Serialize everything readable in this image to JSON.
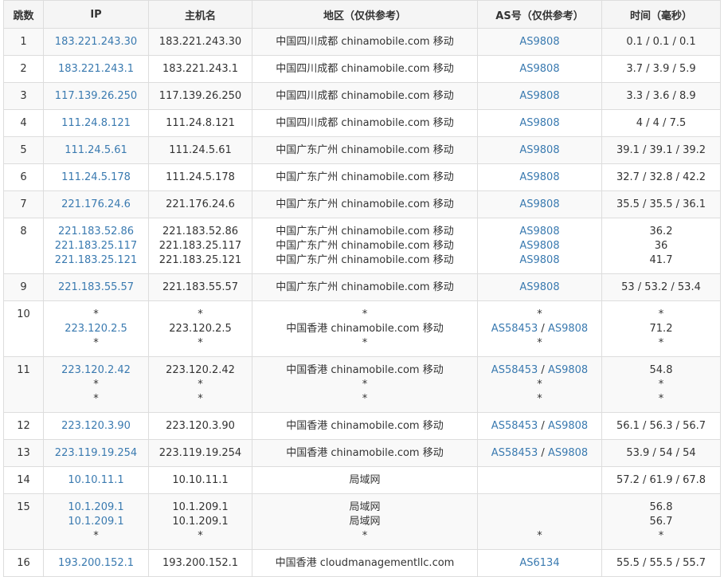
{
  "headers": [
    "跳数",
    "IP",
    "主机名",
    "地区（仅供参考）",
    "AS号（仅供参考）",
    "时间（毫秒）"
  ],
  "rows": [
    {
      "hop": "1",
      "ip": [
        "183.221.243.30"
      ],
      "host": [
        "183.221.243.30"
      ],
      "region": [
        "中国四川成都 chinamobile.com 移动"
      ],
      "as": [
        [
          "AS9808"
        ]
      ],
      "time": [
        "0.1 / 0.1 / 0.1"
      ]
    },
    {
      "hop": "2",
      "ip": [
        "183.221.243.1"
      ],
      "host": [
        "183.221.243.1"
      ],
      "region": [
        "中国四川成都 chinamobile.com 移动"
      ],
      "as": [
        [
          "AS9808"
        ]
      ],
      "time": [
        "3.7 / 3.9 / 5.9"
      ]
    },
    {
      "hop": "3",
      "ip": [
        "117.139.26.250"
      ],
      "host": [
        "117.139.26.250"
      ],
      "region": [
        "中国四川成都 chinamobile.com 移动"
      ],
      "as": [
        [
          "AS9808"
        ]
      ],
      "time": [
        "3.3 / 3.6 / 8.9"
      ]
    },
    {
      "hop": "4",
      "ip": [
        "111.24.8.121"
      ],
      "host": [
        "111.24.8.121"
      ],
      "region": [
        "中国四川成都 chinamobile.com 移动"
      ],
      "as": [
        [
          "AS9808"
        ]
      ],
      "time": [
        "4 / 4 / 7.5"
      ]
    },
    {
      "hop": "5",
      "ip": [
        "111.24.5.61"
      ],
      "host": [
        "111.24.5.61"
      ],
      "region": [
        "中国广东广州 chinamobile.com 移动"
      ],
      "as": [
        [
          "AS9808"
        ]
      ],
      "time": [
        "39.1 / 39.1 / 39.2"
      ]
    },
    {
      "hop": "6",
      "ip": [
        "111.24.5.178"
      ],
      "host": [
        "111.24.5.178"
      ],
      "region": [
        "中国广东广州 chinamobile.com 移动"
      ],
      "as": [
        [
          "AS9808"
        ]
      ],
      "time": [
        "32.7 / 32.8 / 42.2"
      ]
    },
    {
      "hop": "7",
      "ip": [
        "221.176.24.6"
      ],
      "host": [
        "221.176.24.6"
      ],
      "region": [
        "中国广东广州 chinamobile.com 移动"
      ],
      "as": [
        [
          "AS9808"
        ]
      ],
      "time": [
        "35.5 / 35.5 / 36.1"
      ]
    },
    {
      "hop": "8",
      "ip": [
        "221.183.52.86",
        "221.183.25.117",
        "221.183.25.121"
      ],
      "host": [
        "221.183.52.86",
        "221.183.25.117",
        "221.183.25.121"
      ],
      "region": [
        "中国广东广州 chinamobile.com 移动",
        "中国广东广州 chinamobile.com 移动",
        "中国广东广州 chinamobile.com 移动"
      ],
      "as": [
        [
          "AS9808"
        ],
        [
          "AS9808"
        ],
        [
          "AS9808"
        ]
      ],
      "time": [
        "36.2",
        "36",
        "41.7"
      ]
    },
    {
      "hop": "9",
      "ip": [
        "221.183.55.57"
      ],
      "host": [
        "221.183.55.57"
      ],
      "region": [
        "中国广东广州 chinamobile.com 移动"
      ],
      "as": [
        [
          "AS9808"
        ]
      ],
      "time": [
        "53 / 53.2 / 53.4"
      ]
    },
    {
      "hop": "10",
      "ip": [
        "*",
        "223.120.2.5",
        "*"
      ],
      "host": [
        "*",
        "223.120.2.5",
        "*"
      ],
      "region": [
        "*",
        "中国香港 chinamobile.com 移动",
        "*"
      ],
      "as": [
        [
          "*"
        ],
        [
          "AS58453",
          "AS9808"
        ],
        [
          "*"
        ]
      ],
      "time": [
        "*",
        "71.2",
        "*"
      ]
    },
    {
      "hop": "11",
      "ip": [
        "223.120.2.42",
        "*",
        "*"
      ],
      "host": [
        "223.120.2.42",
        "*",
        "*"
      ],
      "region": [
        "中国香港 chinamobile.com 移动",
        "*",
        "*"
      ],
      "as": [
        [
          "AS58453",
          "AS9808"
        ],
        [
          "*"
        ],
        [
          "*"
        ]
      ],
      "time": [
        "54.8",
        "*",
        "*"
      ]
    },
    {
      "hop": "12",
      "ip": [
        "223.120.3.90"
      ],
      "host": [
        "223.120.3.90"
      ],
      "region": [
        "中国香港 chinamobile.com 移动"
      ],
      "as": [
        [
          "AS58453",
          "AS9808"
        ]
      ],
      "time": [
        "56.1 / 56.3 / 56.7"
      ]
    },
    {
      "hop": "13",
      "ip": [
        "223.119.19.254"
      ],
      "host": [
        "223.119.19.254"
      ],
      "region": [
        "中国香港 chinamobile.com 移动"
      ],
      "as": [
        [
          "AS58453",
          "AS9808"
        ]
      ],
      "time": [
        "53.9 / 54 / 54"
      ]
    },
    {
      "hop": "14",
      "ip": [
        "10.10.11.1"
      ],
      "host": [
        "10.10.11.1"
      ],
      "region": [
        "局域网"
      ],
      "as": [
        [
          ""
        ]
      ],
      "time": [
        "57.2 / 61.9 / 67.8"
      ]
    },
    {
      "hop": "15",
      "ip": [
        "10.1.209.1",
        "10.1.209.1",
        "*"
      ],
      "host": [
        "10.1.209.1",
        "10.1.209.1",
        "*"
      ],
      "region": [
        "局域网",
        "局域网",
        "*"
      ],
      "as": [
        [
          ""
        ],
        [
          ""
        ],
        [
          "*"
        ]
      ],
      "time": [
        "56.8",
        "56.7",
        "*"
      ]
    },
    {
      "hop": "16",
      "ip": [
        "193.200.152.1"
      ],
      "host": [
        "193.200.152.1"
      ],
      "region": [
        "中国香港 cloudmanagementllc.com"
      ],
      "as": [
        [
          "AS6134"
        ]
      ],
      "time": [
        "55.5 / 55.5 / 55.7"
      ]
    }
  ]
}
